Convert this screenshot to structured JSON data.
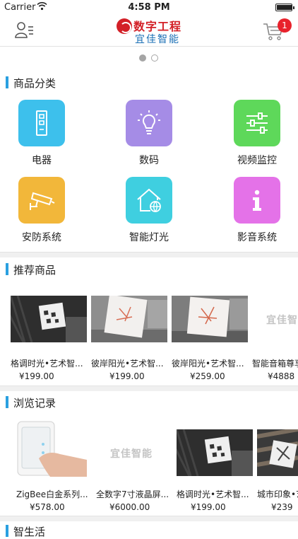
{
  "status_bar": {
    "carrier": "Carrier",
    "time": "4:58 PM",
    "battery_level": 0.95
  },
  "header": {
    "logo_title": "数字工程",
    "logo_subtitle": "宜佳智能",
    "cart_count": "1",
    "brand_red": "#d32027",
    "brand_blue": "#1a6fb5",
    "badge_color": "#e8222c"
  },
  "banner": {
    "page_count": 2,
    "current_page": 1
  },
  "categories": {
    "title": "商品分类",
    "items": [
      {
        "label": "电器",
        "color": "#3dc0ec",
        "icon": "appliance-icon"
      },
      {
        "label": "数码",
        "color": "#a58ce6",
        "icon": "bulb-icon"
      },
      {
        "label": "视频监控",
        "color": "#5ed85a",
        "icon": "sliders-icon"
      },
      {
        "label": "安防系统",
        "color": "#f2b73a",
        "icon": "camera-icon"
      },
      {
        "label": "智能灯光",
        "color": "#3fcfe0",
        "icon": "smart-home-icon"
      },
      {
        "label": "影音系统",
        "color": "#e472e8",
        "icon": "info-icon"
      }
    ]
  },
  "recommended": {
    "title": "推荐商品",
    "items": [
      {
        "name": "格调时光•艺术智...",
        "price": "¥199.00"
      },
      {
        "name": "彼岸阳光•艺术智...",
        "price": "¥199.00"
      },
      {
        "name": "彼岸阳光•艺术智...",
        "price": "¥259.00"
      },
      {
        "name": "智能音箱尊享",
        "price": "¥4888",
        "placeholder": "宜佳智"
      }
    ]
  },
  "history": {
    "title": "浏览记录",
    "items": [
      {
        "name": "ZigBee白金系列...",
        "price": "¥578.00"
      },
      {
        "name": "全数字7寸液晶屏...",
        "price": "¥6000.00",
        "placeholder": "宜佳智能"
      },
      {
        "name": "格调时光•艺术智...",
        "price": "¥199.00"
      },
      {
        "name": "城市印象•艺",
        "price": "¥239"
      }
    ]
  },
  "next_section": {
    "title": "智生活"
  },
  "accent_color": "#2aa0e0"
}
